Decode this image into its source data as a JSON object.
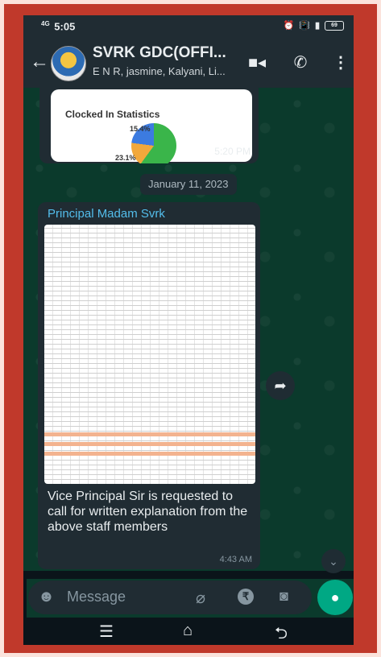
{
  "status_bar": {
    "network": "4G",
    "time": "5:05",
    "battery": "69"
  },
  "header": {
    "title": "SVRK GDC(OFFI...",
    "subtitle": "E N R, jasmine, Kalyani, Li..."
  },
  "messages": [
    {
      "type": "image",
      "image_title": "Clocked In Statistics",
      "pie_labels": [
        "15.4%",
        "23.1%"
      ],
      "time": "5:20 PM"
    },
    {
      "type": "date",
      "date": "January 11, 2023"
    },
    {
      "type": "image_with_caption",
      "sender": "Principal Madam Svrk",
      "caption": "Vice Principal Sir is requested to call for written explanation from the above staff members",
      "time": "4:43 AM"
    }
  ],
  "composer": {
    "placeholder": "Message"
  },
  "icons": {
    "back": "arrow-left-icon",
    "video": "video-call-icon",
    "call": "phone-icon",
    "menu": "more-vert-icon",
    "emoji": "emoji-icon",
    "attach": "attach-icon",
    "payment": "rupee-icon",
    "camera": "camera-icon",
    "mic": "mic-icon",
    "share": "forward-icon",
    "scroll": "chevron-down-icon"
  },
  "colors": {
    "accent": "#00a884",
    "sender": "#53bdeb",
    "bubble": "#202c33",
    "frame": "#c0392b"
  }
}
